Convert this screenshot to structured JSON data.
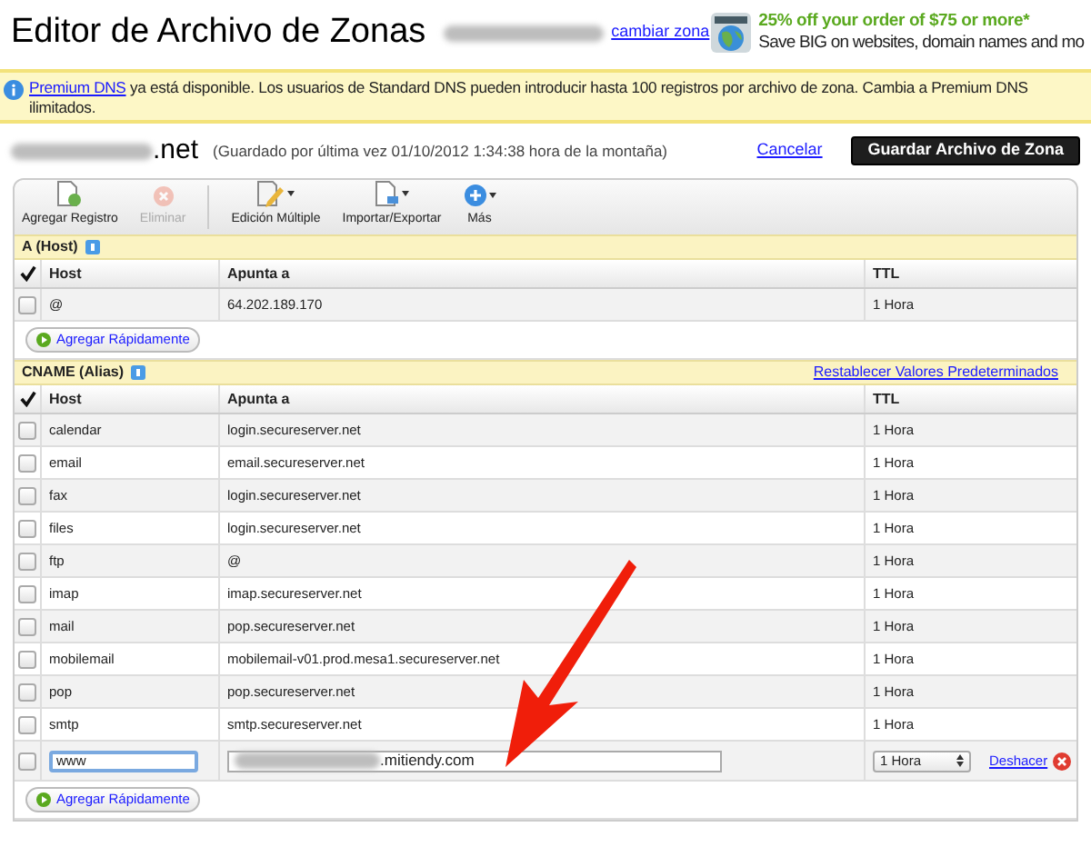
{
  "header": {
    "title": "Editor de Archivo de Zonas",
    "change_zone_link": "cambiar zona"
  },
  "ad": {
    "headline": "25% off your order of $75 or more*",
    "text": "Save BIG on websites, domain names and mo"
  },
  "notice": {
    "link": "Premium DNS",
    "text": "ya está disponible. Los usuarios de Standard DNS pueden introducir hasta 100 registros por archivo de zona. Cambia a Premium DNS",
    "text_line2": "ilimitados."
  },
  "zone": {
    "domain_suffix": ".net",
    "saved": "(Guardado por última vez 01/10/2012 1:34:38 hora de la montaña)",
    "cancel": "Cancelar",
    "save_button": "Guardar Archivo de Zona"
  },
  "toolbar": [
    {
      "label": "Agregar Registro",
      "disabled": false,
      "menu": false
    },
    {
      "label": "Eliminar",
      "disabled": true,
      "menu": false
    },
    {
      "label": "Edición Múltiple",
      "disabled": false,
      "menu": true
    },
    {
      "label": "Importar/Exportar",
      "disabled": false,
      "menu": true
    },
    {
      "label": "Más",
      "disabled": false,
      "menu": true
    }
  ],
  "sections": [
    {
      "title": "A (Host)",
      "columns": [
        "Host",
        "Apunta a",
        "TTL"
      ],
      "quick_add": "Agregar Rápidamente",
      "rows": [
        {
          "kind": "text",
          "checked": false,
          "host": "@",
          "points_to": "64.202.189.170",
          "ttl": "1 Hora"
        }
      ]
    },
    {
      "title": "CNAME (Alias)",
      "reset_link": "Restablecer Valores Predeterminados",
      "columns": [
        "Host",
        "Apunta a",
        "TTL"
      ],
      "quick_add": "Agregar Rápidamente",
      "rows": [
        {
          "kind": "text",
          "checked": false,
          "host": "calendar",
          "points_to": "login.secureserver.net",
          "ttl": "1 Hora"
        },
        {
          "kind": "text",
          "checked": false,
          "host": "email",
          "points_to": "email.secureserver.net",
          "ttl": "1 Hora"
        },
        {
          "kind": "text",
          "checked": false,
          "host": "fax",
          "points_to": "login.secureserver.net",
          "ttl": "1 Hora"
        },
        {
          "kind": "text",
          "checked": false,
          "host": "files",
          "points_to": "login.secureserver.net",
          "ttl": "1 Hora"
        },
        {
          "kind": "text",
          "checked": false,
          "host": "ftp",
          "points_to": "@",
          "ttl": "1 Hora"
        },
        {
          "kind": "text",
          "checked": false,
          "host": "imap",
          "points_to": "imap.secureserver.net",
          "ttl": "1 Hora"
        },
        {
          "kind": "text",
          "checked": false,
          "host": "mail",
          "points_to": "pop.secureserver.net",
          "ttl": "1 Hora"
        },
        {
          "kind": "text",
          "checked": false,
          "host": "mobilemail",
          "points_to": "mobilemail-v01.prod.mesa1.secureserver.net",
          "ttl": "1 Hora"
        },
        {
          "kind": "text",
          "checked": false,
          "host": "pop",
          "points_to": "pop.secureserver.net",
          "ttl": "1 Hora"
        },
        {
          "kind": "text",
          "checked": false,
          "host": "smtp",
          "points_to": "smtp.secureserver.net",
          "ttl": "1 Hora"
        },
        {
          "kind": "edit",
          "checked": false,
          "host": "www",
          "points_to": ".mitiendy.com",
          "ttl": "1 Hora",
          "undo": "Deshacer"
        }
      ]
    }
  ]
}
